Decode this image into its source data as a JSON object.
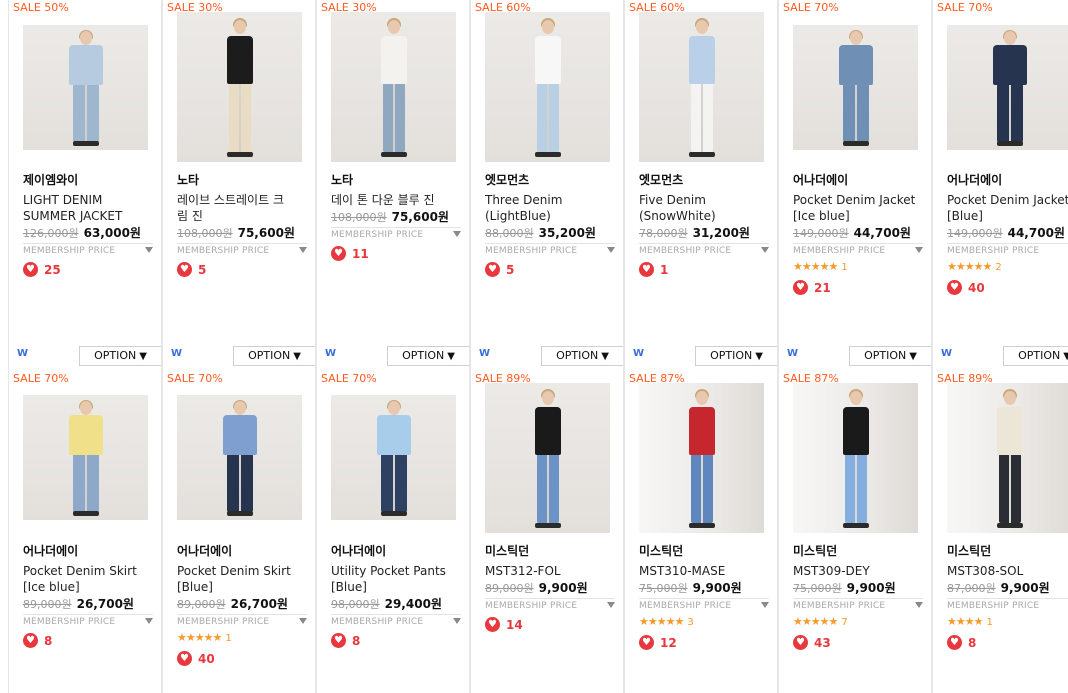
{
  "row1": [
    {
      "sale": "SALE 50%",
      "brand": "제이엠와이",
      "name": "LIGHT DENIM\nSUMMER JACKET",
      "original_price": "126,000원",
      "price": "63,000원",
      "membership": "MEMBERSHIP PRICE",
      "likes": "25",
      "stars": "",
      "reviews": "",
      "w": "W",
      "option": "OPTION",
      "photo": "short",
      "top": "#b7cbe0",
      "bottom": "#9fb6cf",
      "skin": "#e8c9b0"
    },
    {
      "sale": "SALE 30%",
      "brand": "노타",
      "name": "레이브 스트레이트 크\n림 진",
      "original_price": "108,000원",
      "price": "75,600원",
      "membership": "MEMBERSHIP PRICE",
      "likes": "5",
      "stars": "",
      "reviews": "",
      "w": "W",
      "option": "OPTION",
      "photo": "tall",
      "top": "#1c1c1c",
      "bottom": "#e8dcc5",
      "skin": "#e8c9b0"
    },
    {
      "sale": "SALE 30%",
      "brand": "노타",
      "name": "데이 톤 다운 블루 진",
      "original_price": "108,000원",
      "price": "75,600원",
      "membership": "MEMBERSHIP PRICE",
      "likes": "11",
      "stars": "",
      "reviews": "",
      "w": "W",
      "option": "OPTION",
      "photo": "tall",
      "top": "#f4f2ee",
      "bottom": "#8fa7bf",
      "skin": "#e8c9b0"
    },
    {
      "sale": "SALE 60%",
      "brand": "엣모먼츠",
      "name": "Three Denim\n(LightBlue)",
      "original_price": "88,000원",
      "price": "35,200원",
      "membership": "MEMBERSHIP PRICE",
      "likes": "5",
      "stars": "",
      "reviews": "",
      "w": "W",
      "option": "OPTION",
      "photo": "tall",
      "top": "#f7f7f7",
      "bottom": "#b9cfe4",
      "skin": "#e8c9b0"
    },
    {
      "sale": "SALE 60%",
      "brand": "엣모먼츠",
      "name": "Five Denim\n(SnowWhite)",
      "original_price": "78,000원",
      "price": "31,200원",
      "membership": "MEMBERSHIP PRICE",
      "likes": "1",
      "stars": "",
      "reviews": "",
      "w": "W",
      "option": "OPTION",
      "photo": "tall",
      "top": "#b9d0e8",
      "bottom": "#f3f3f1",
      "skin": "#e8c9b0"
    },
    {
      "sale": "SALE 70%",
      "brand": "어나더에이",
      "name": "Pocket Denim Jacket\n[Ice blue]",
      "original_price": "149,000원",
      "price": "44,700원",
      "membership": "MEMBERSHIP PRICE",
      "likes": "21",
      "stars": "★★★★★",
      "reviews": "1",
      "w": "W",
      "option": "OPTION",
      "photo": "short",
      "top": "#6f8fb5",
      "bottom": "#6f8fb5",
      "skin": "#e8c9b0"
    },
    {
      "sale": "SALE 70%",
      "brand": "어나더에이",
      "name": "Pocket Denim Jacket\n[Blue]",
      "original_price": "149,000원",
      "price": "44,700원",
      "membership": "MEMBERSHIP PRICE",
      "likes": "40",
      "stars": "★★★★★",
      "reviews": "2",
      "w": "W",
      "option": "OPTION",
      "photo": "short",
      "top": "#26344f",
      "bottom": "#26344f",
      "skin": "#e8c9b0"
    }
  ],
  "row2": [
    {
      "sale": "SALE 70%",
      "brand": "어나더에이",
      "name": "Pocket Denim Skirt\n[Ice blue]",
      "original_price": "89,000원",
      "price": "26,700원",
      "membership": "MEMBERSHIP PRICE",
      "likes": "8",
      "stars": "",
      "reviews": "",
      "photo": "short",
      "top": "#f1e08a",
      "bottom": "#8ea8c9",
      "skin": "#e8c9b0"
    },
    {
      "sale": "SALE 70%",
      "brand": "어나더에이",
      "name": "Pocket Denim Skirt\n[Blue]",
      "original_price": "89,000원",
      "price": "26,700원",
      "membership": "MEMBERSHIP PRICE",
      "likes": "40",
      "stars": "★★★★★",
      "reviews": "1",
      "photo": "short",
      "top": "#7f9fd0",
      "bottom": "#26344f",
      "skin": "#e8c9b0"
    },
    {
      "sale": "SALE 70%",
      "brand": "어나더에이",
      "name": "Utility Pocket Pants\n[Blue]",
      "original_price": "98,000원",
      "price": "29,400원",
      "membership": "MEMBERSHIP PRICE",
      "likes": "8",
      "stars": "",
      "reviews": "",
      "photo": "short",
      "top": "#a8cdea",
      "bottom": "#2e4163",
      "skin": "#e8c9b0"
    },
    {
      "sale": "SALE 89%",
      "brand": "미스틱던",
      "name": "MST312-FOL",
      "original_price": "89,000원",
      "price": "9,900원",
      "membership": "MEMBERSHIP PRICE",
      "likes": "14",
      "stars": "",
      "reviews": "",
      "photo": "tall",
      "top": "#1a1a1a",
      "bottom": "#6d93c6",
      "skin": "#e8c9b0"
    },
    {
      "sale": "SALE 87%",
      "brand": "미스틱던",
      "name": "MST310-MASE",
      "original_price": "75,000원",
      "price": "9,900원",
      "membership": "MEMBERSHIP PRICE",
      "likes": "12",
      "stars": "★★★★★",
      "reviews": "3",
      "photo": "window",
      "top": "#c6262e",
      "bottom": "#5f86bd",
      "skin": "#e8c9b0"
    },
    {
      "sale": "SALE 87%",
      "brand": "미스틱던",
      "name": "MST309-DEY",
      "original_price": "75,000원",
      "price": "9,900원",
      "membership": "MEMBERSHIP PRICE",
      "likes": "43",
      "stars": "★★★★★",
      "reviews": "7",
      "photo": "window",
      "top": "#1a1a1a",
      "bottom": "#85aee0",
      "skin": "#e8c9b0"
    },
    {
      "sale": "SALE 89%",
      "brand": "미스틱던",
      "name": "MST308-SOL",
      "original_price": "87,000원",
      "price": "9,900원",
      "membership": "MEMBERSHIP PRICE",
      "likes": "8",
      "stars": "★★★★",
      "reviews": "1",
      "photo": "window",
      "top": "#ece6d8",
      "bottom": "#2a2d33",
      "skin": "#e8c9b0"
    }
  ],
  "icons": {
    "heart": "heart-icon",
    "caret": "caret-down-icon"
  },
  "colors": {
    "sale": "#ff5a1f",
    "heart": "#e8383d",
    "stars": "#f39a2c",
    "w_tag": "#3a6fd8"
  }
}
